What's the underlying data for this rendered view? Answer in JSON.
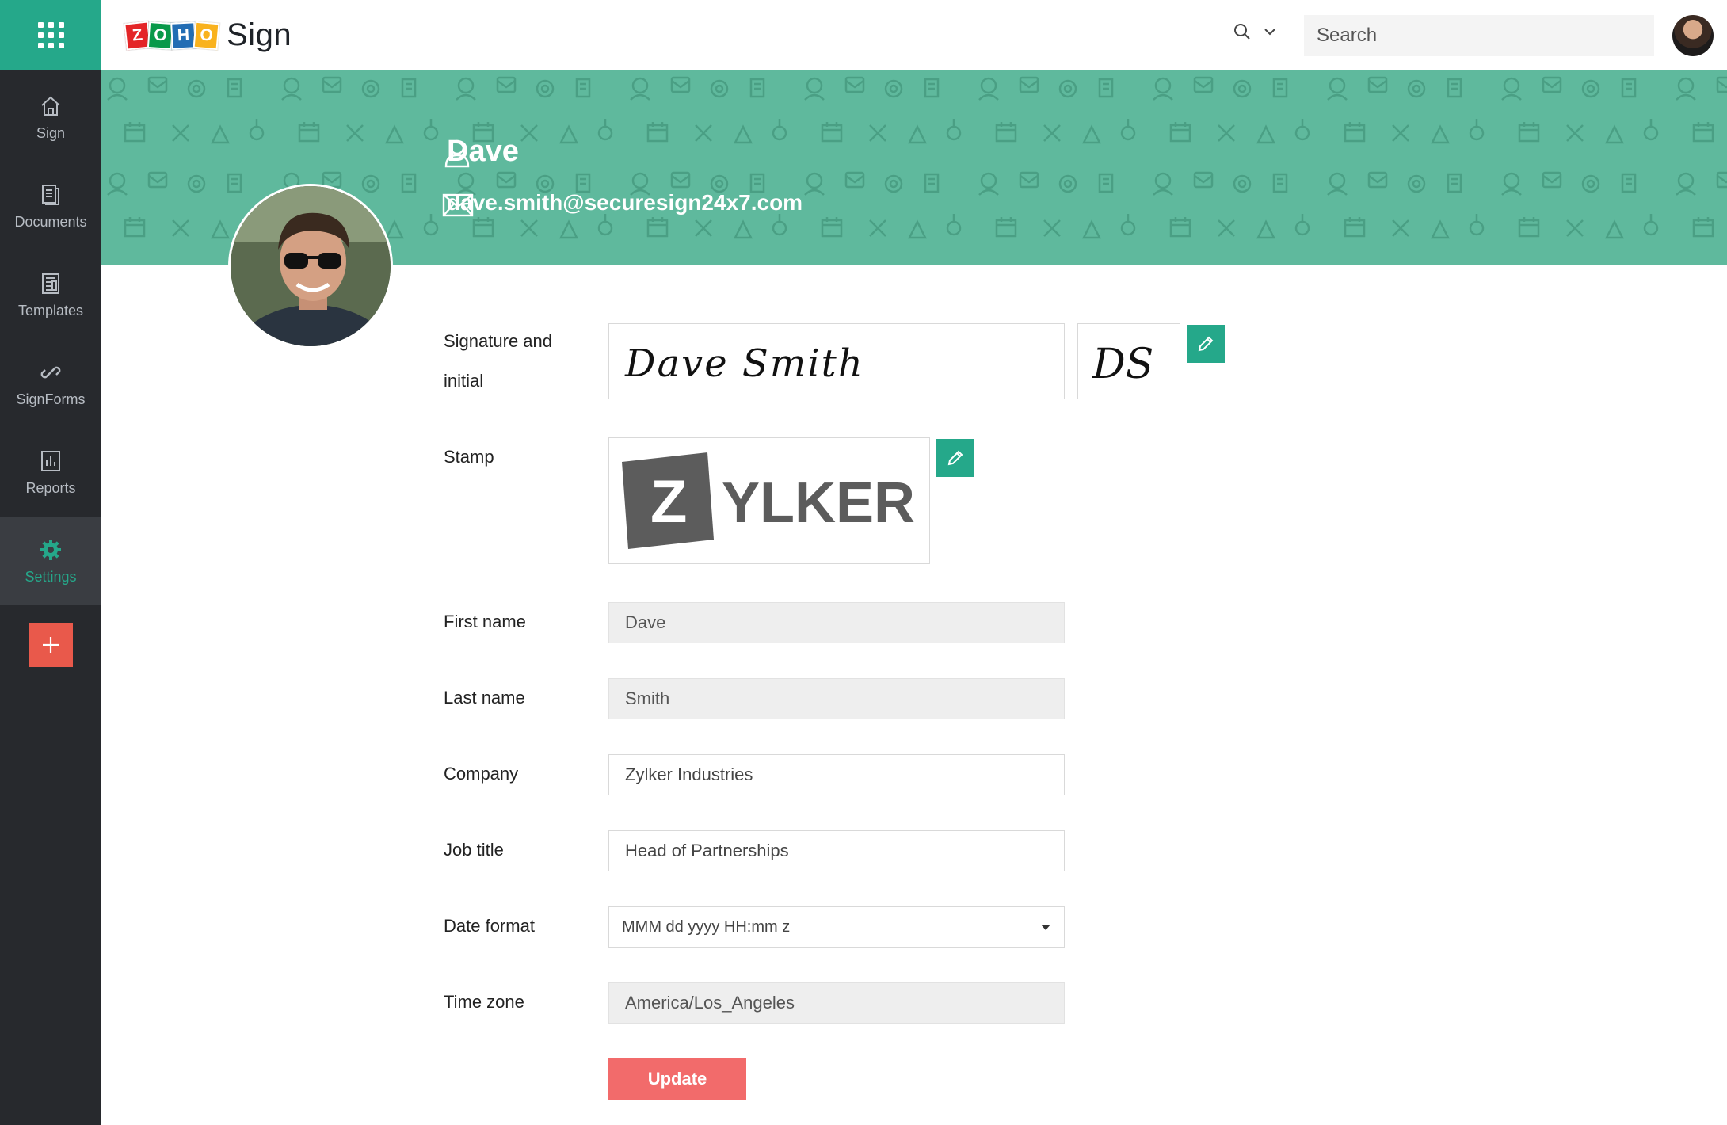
{
  "app": {
    "logo_letters": [
      "Z",
      "O",
      "H",
      "O"
    ],
    "logo_colors": [
      "#e42527",
      "#089949",
      "#226db4",
      "#f9b21d"
    ],
    "name": "Sign"
  },
  "sidebar": {
    "items": [
      {
        "label": "Sign",
        "icon": "home-icon"
      },
      {
        "label": "Documents",
        "icon": "documents-icon"
      },
      {
        "label": "Templates",
        "icon": "templates-icon"
      },
      {
        "label": "SignForms",
        "icon": "link-icon"
      },
      {
        "label": "Reports",
        "icon": "reports-icon"
      },
      {
        "label": "Settings",
        "icon": "gear-icon",
        "active": true
      }
    ],
    "add_label": "+"
  },
  "header": {
    "search_placeholder": "Search"
  },
  "profile": {
    "name": "Dave",
    "email": "dave.smith@securesign24x7.com",
    "signature": "Dave Smith",
    "initials": "DS",
    "stamp": {
      "letter": "Z",
      "text": "YLKER"
    }
  },
  "form": {
    "signature_label_line1": "Signature and",
    "signature_label_line2": "initial",
    "stamp_label": "Stamp",
    "first_name_label": "First name",
    "first_name": "Dave",
    "last_name_label": "Last name",
    "last_name": "Smith",
    "company_label": "Company",
    "company": "Zylker Industries",
    "job_title_label": "Job title",
    "job_title": "Head of Partnerships",
    "date_format_label": "Date format",
    "date_format": "MMM dd yyyy HH:mm z",
    "time_zone_label": "Time zone",
    "time_zone": "America/Los_Angeles",
    "update_label": "Update"
  },
  "colors": {
    "accent": "#25a88a",
    "banner": "#5fb99d",
    "sidebar": "#27292d",
    "update_button": "#f26b6b",
    "add_button": "#e9594b"
  }
}
